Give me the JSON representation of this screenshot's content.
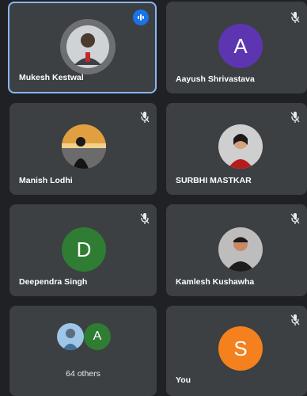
{
  "participants": [
    {
      "name": "Mukesh Kestwal",
      "speaking": true
    },
    {
      "name": "Aayush Shrivastava",
      "initial": "A",
      "color": "#5e35b1",
      "muted": true
    },
    {
      "name": "Manish Lodhi",
      "muted": true
    },
    {
      "name": "SURBHI MASTKAR",
      "muted": true
    },
    {
      "name": "Deependra Singh",
      "initial": "D",
      "color": "#2e7d32",
      "muted": true
    },
    {
      "name": "Kamlesh Kushawha",
      "muted": true
    },
    {
      "name": "You",
      "initial": "S",
      "color": "#f4811e",
      "muted": true
    }
  ],
  "others": {
    "label": "64 others",
    "initial": "A",
    "color": "#2e7d32"
  },
  "colors": {
    "tile_bg": "#3c4043",
    "page_bg": "#202124",
    "active_border": "#8ab4f8",
    "speaking_badge": "#1a73e8"
  }
}
